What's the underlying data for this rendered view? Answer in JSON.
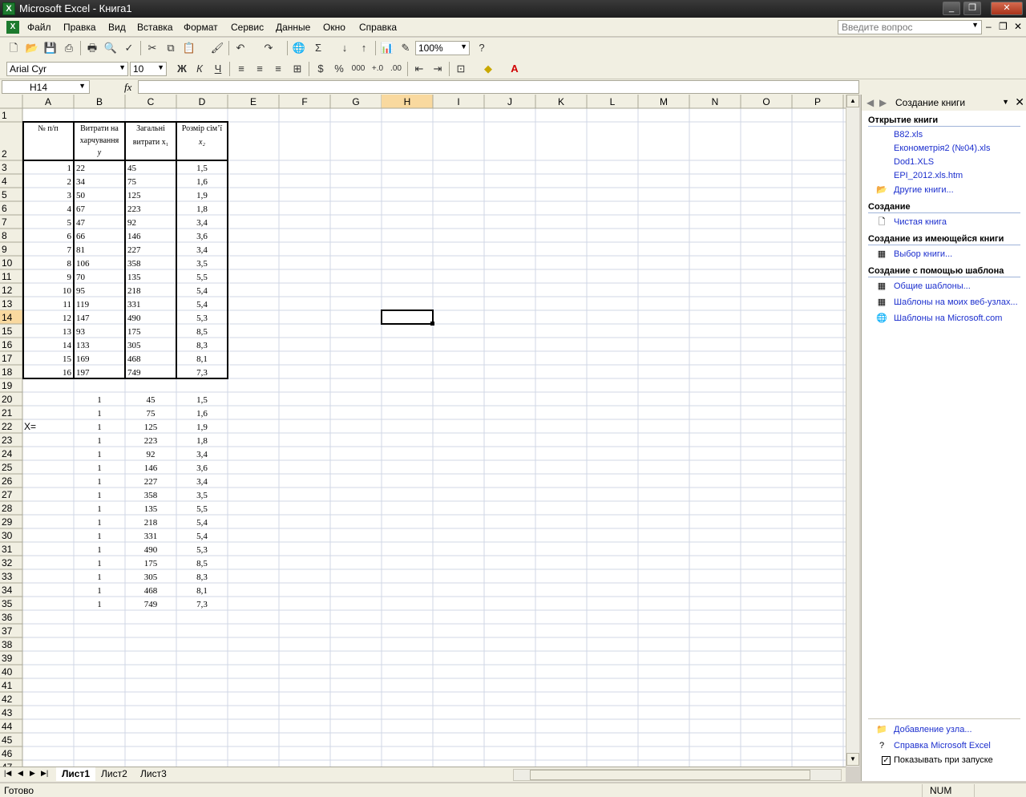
{
  "window": {
    "title": "Microsoft Excel - Книга1",
    "icon": "excel-icon"
  },
  "menu": {
    "items": [
      "Файл",
      "Правка",
      "Вид",
      "Вставка",
      "Формат",
      "Сервис",
      "Данные",
      "Окно",
      "Справка"
    ],
    "help_placeholder": "Введите вопрос"
  },
  "toolbar": {
    "zoom": "100%",
    "font_name": "Arial Cyr",
    "font_size": "10",
    "bold": "Ж",
    "italic": "К",
    "underline": "Ч"
  },
  "formula_bar": {
    "cell_ref": "H14",
    "fx": "fx",
    "content": ""
  },
  "sheet": {
    "columns": [
      "A",
      "B",
      "C",
      "D",
      "E",
      "F",
      "G",
      "H",
      "I",
      "J",
      "K",
      "L",
      "M",
      "N",
      "O",
      "P"
    ],
    "selected_cell": "H14",
    "header_row": {
      "a": "№ п/п",
      "b": [
        "Витрати на",
        "харчування",
        "y"
      ],
      "c": [
        "Загальні",
        "витрати x₁"
      ],
      "d": [
        "Розмір сім’ї",
        "x₂"
      ]
    },
    "table1_rows": [
      [
        "1",
        "22",
        "45",
        "1,5"
      ],
      [
        "2",
        "34",
        "75",
        "1,6"
      ],
      [
        "3",
        "50",
        "125",
        "1,9"
      ],
      [
        "4",
        "67",
        "223",
        "1,8"
      ],
      [
        "5",
        "47",
        "92",
        "3,4"
      ],
      [
        "6",
        "66",
        "146",
        "3,6"
      ],
      [
        "7",
        "81",
        "227",
        "3,4"
      ],
      [
        "8",
        "106",
        "358",
        "3,5"
      ],
      [
        "9",
        "70",
        "135",
        "5,5"
      ],
      [
        "10",
        "95",
        "218",
        "5,4"
      ],
      [
        "11",
        "119",
        "331",
        "5,4"
      ],
      [
        "12",
        "147",
        "490",
        "5,3"
      ],
      [
        "13",
        "93",
        "175",
        "8,5"
      ],
      [
        "14",
        "133",
        "305",
        "8,3"
      ],
      [
        "15",
        "169",
        "468",
        "8,1"
      ],
      [
        "16",
        "197",
        "749",
        "7,3"
      ]
    ],
    "x_label": "X=",
    "matrix_rows": [
      [
        "1",
        "45",
        "1,5"
      ],
      [
        "1",
        "75",
        "1,6"
      ],
      [
        "1",
        "125",
        "1,9"
      ],
      [
        "1",
        "223",
        "1,8"
      ],
      [
        "1",
        "92",
        "3,4"
      ],
      [
        "1",
        "146",
        "3,6"
      ],
      [
        "1",
        "227",
        "3,4"
      ],
      [
        "1",
        "358",
        "3,5"
      ],
      [
        "1",
        "135",
        "5,5"
      ],
      [
        "1",
        "218",
        "5,4"
      ],
      [
        "1",
        "331",
        "5,4"
      ],
      [
        "1",
        "490",
        "5,3"
      ],
      [
        "1",
        "175",
        "8,5"
      ],
      [
        "1",
        "305",
        "8,3"
      ],
      [
        "1",
        "468",
        "8,1"
      ],
      [
        "1",
        "749",
        "7,3"
      ]
    ],
    "tabs": [
      "Лист1",
      "Лист2",
      "Лист3"
    ],
    "active_tab": "Лист1"
  },
  "task_pane": {
    "title": "Создание книги",
    "open_section": "Открытие книги",
    "recent_files": [
      "B82.xls",
      "Економетрія2 (№04).xls",
      "Dod1.XLS",
      "EPI_2012.xls.htm"
    ],
    "more_books": "Другие книги...",
    "create_section": "Создание",
    "blank_book": "Чистая книга",
    "from_existing_section": "Создание из имеющейся книги",
    "choose_book": "Выбор книги...",
    "template_section": "Создание с помощью шаблона",
    "templates": [
      "Общие шаблоны...",
      "Шаблоны на моих веб-узлах...",
      "Шаблоны на Microsoft.com"
    ],
    "add_site": "Добавление узла...",
    "excel_help": "Справка Microsoft Excel",
    "show_on_start": "Показывать при запуске"
  },
  "status": {
    "text": "Готово",
    "num": "NUM"
  },
  "colors": {
    "grid_line": "#d0d7e5",
    "header_bg": "#f1efe2",
    "selected_header": "#f9d99f",
    "link": "#1c2fce"
  }
}
